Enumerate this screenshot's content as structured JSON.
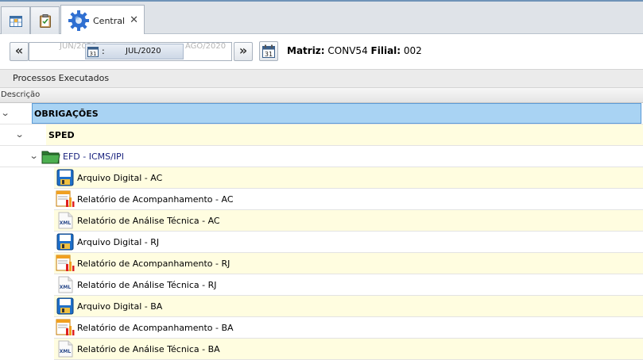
{
  "tabs": [
    {
      "icon": "grid-icon"
    },
    {
      "icon": "clipboard-icon"
    },
    {
      "icon": "gear-icon",
      "label": "Central",
      "close": "✕"
    }
  ],
  "toolbar": {
    "prev_label": "«",
    "next_label": "»",
    "period_prev": "JUN/2020",
    "period_current": "JUL/2020",
    "period_next": "AGO/2020",
    "period_colon": ":",
    "matriz_label": "Matriz:",
    "matriz_value": "CONV54",
    "filial_label": "Filial:",
    "filial_value": "002"
  },
  "section": {
    "title": "Processos Executados"
  },
  "table": {
    "column": "Descrição"
  },
  "tree": [
    {
      "label": "OBRIGAÇÕES",
      "level": 0,
      "icon": "",
      "expanded": true
    },
    {
      "label": "SPED",
      "level": 1,
      "icon": "",
      "expanded": true
    },
    {
      "label": "EFD - ICMS/IPI",
      "level": 2,
      "icon": "folder-icon",
      "expanded": true
    },
    {
      "label": "Arquivo Digital - AC",
      "level": 3,
      "icon": "floppy-icon"
    },
    {
      "label": "Relatório de Acompanhamento - AC",
      "level": 3,
      "icon": "report-chart-icon"
    },
    {
      "label": "Relatório de Análise Técnica - AC",
      "level": 3,
      "icon": "xml-file-icon"
    },
    {
      "label": "Arquivo Digital - RJ",
      "level": 3,
      "icon": "floppy-icon"
    },
    {
      "label": "Relatório de Acompanhamento - RJ",
      "level": 3,
      "icon": "report-chart-icon"
    },
    {
      "label": "Relatório de Análise Técnica - RJ",
      "level": 3,
      "icon": "xml-file-icon"
    },
    {
      "label": "Arquivo Digital - BA",
      "level": 3,
      "icon": "floppy-icon"
    },
    {
      "label": "Relatório de Acompanhamento - BA",
      "level": 3,
      "icon": "report-chart-icon"
    },
    {
      "label": "Relatório de Análise Técnica - BA",
      "level": 3,
      "icon": "xml-file-icon"
    }
  ],
  "colors": {
    "selected_row": "#a9d3f3",
    "alt_row": "#fffde0",
    "white_row": "#ffffff"
  },
  "xml_icon_text": "XML"
}
